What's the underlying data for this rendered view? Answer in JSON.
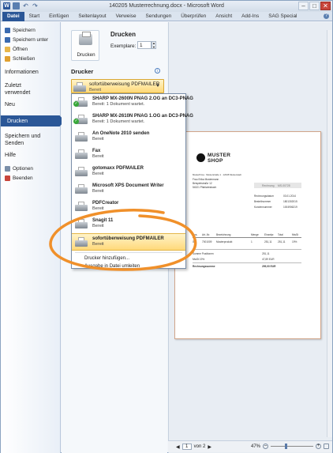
{
  "window": {
    "title": "140205 Musterrechnung.docx - Microsoft Word",
    "controls": {
      "minimize": "–",
      "maximize": "□",
      "close": "✕"
    }
  },
  "qat": {
    "app_icon": "W",
    "undo": "↶",
    "redo": "↷"
  },
  "tabs": [
    "Datei",
    "Start",
    "Einfügen",
    "Seitenlayout",
    "Verweise",
    "Sendungen",
    "Überprüfen",
    "Ansicht",
    "Add-Ins",
    "SAG Special"
  ],
  "backstage": {
    "items_small": [
      {
        "label": "Speichern",
        "icon": "save-icon",
        "color": "#3a6ab0"
      },
      {
        "label": "Speichern unter",
        "icon": "save-as-icon",
        "color": "#3a6ab0"
      },
      {
        "label": "Öffnen",
        "icon": "folder-icon",
        "color": "#e8b64a"
      },
      {
        "label": "Schließen",
        "icon": "close-doc-icon",
        "color": "#e0a030"
      }
    ],
    "info": "Informationen",
    "recent": "Zuletzt verwendet",
    "new": "Neu",
    "print": "Drucken",
    "save_send": "Speichern und Senden",
    "help": "Hilfe",
    "options": "Optionen",
    "exit": "Beenden"
  },
  "print": {
    "heading": "Drucken",
    "button_label": "Drucken",
    "copies_label": "Exemplare:",
    "copies_value": "1",
    "printer_heading": "Drucker",
    "selected_printer": {
      "name": "sofortüberweisung PDFMAILER",
      "status": "Bereit"
    }
  },
  "printer_list": [
    {
      "name": "SHARP MX-2600N PNAG 2.OG an DC3-PNAG",
      "status": "Bereit: 1 Dokument wartet.",
      "check": true
    },
    {
      "name": "SHARP MX-2610N PNAG 1.OG an DC3-PNAG",
      "status": "Bereit: 1 Dokument wartet.",
      "check": true
    },
    {
      "name": "An OneNote 2010 senden",
      "status": "Bereit",
      "check": false
    },
    {
      "name": "Fax",
      "status": "Bereit",
      "check": false
    },
    {
      "name": "gotomaxx PDFMAILER",
      "status": "Bereit",
      "check": false
    },
    {
      "name": "Microsoft XPS Document Writer",
      "status": "Bereit",
      "check": false
    },
    {
      "name": "PDFCreator",
      "status": "Bereit",
      "check": false
    },
    {
      "name": "Snagit 11",
      "status": "Bereit",
      "check": false
    },
    {
      "name": "sofortüberweisung PDFMAILER",
      "status": "Bereit",
      "check": false,
      "selected": true
    }
  ],
  "printer_actions": {
    "add": "Drucker hinzufügen...",
    "file": "Ausgabe in Datei umleiten"
  },
  "annotation": {
    "color": "#f0902a"
  },
  "preview": {
    "logo_line1": "MUSTER",
    "logo_line2": "SHOP",
    "sender_line": "Musterfirma · Musterstraße 1 · 12345 Musterstadt",
    "recipient": [
      "Frau Erika Mustermann",
      "Beispielstraße 12",
      "54321 Pfahlwiesbach"
    ],
    "invoice_label": "Rechnung",
    "invoice_number": "MS-00728",
    "meta": [
      {
        "label": "Rechnungsdatum",
        "value": "03.01.2014"
      },
      {
        "label": "Bestellnummer",
        "value": "1801302015"
      },
      {
        "label": "Kundennummer",
        "value": "1004906219"
      }
    ],
    "table_headers": [
      "Pos.",
      "Art.-Nr.",
      "Bezeichnung",
      "Menge",
      "Einzelpr.",
      "Total",
      "MwSt"
    ],
    "table_row": [
      "001",
      "7001009",
      "Musterprodukt",
      "1",
      "251,11",
      "251,11",
      "19%"
    ],
    "totals": [
      {
        "label": "Summe Positionen",
        "value": "251,11"
      },
      {
        "label": "MwSt 19%",
        "value": "47,89 EUR"
      },
      {
        "label": "Rechnungssumme",
        "value": "299,00 EUR"
      }
    ]
  },
  "statusbar": {
    "page_current": "1",
    "page_of": "von 2",
    "zoom": "47%"
  }
}
